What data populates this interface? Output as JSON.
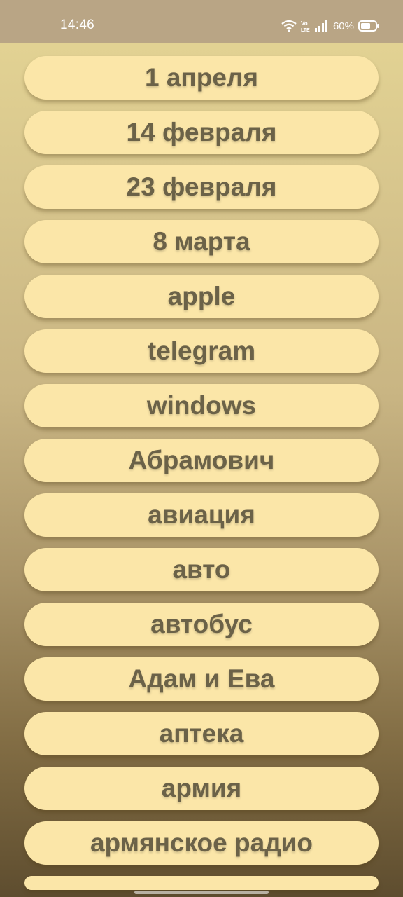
{
  "status_bar": {
    "time": "14:46",
    "network_label": "Vo LTE",
    "battery": "60%"
  },
  "topics": [
    "1 апреля",
    "14 февраля",
    "23 февраля",
    "8 марта",
    "apple",
    "telegram",
    "windows",
    "Абрамович",
    "авиация",
    "авто",
    "автобус",
    "Адам и Ева",
    "аптека",
    "армия",
    "армянское радио"
  ],
  "colors": {
    "button_bg": "#fbe6a8",
    "button_text": "#6b6248",
    "status_bar": "#b9a585"
  }
}
